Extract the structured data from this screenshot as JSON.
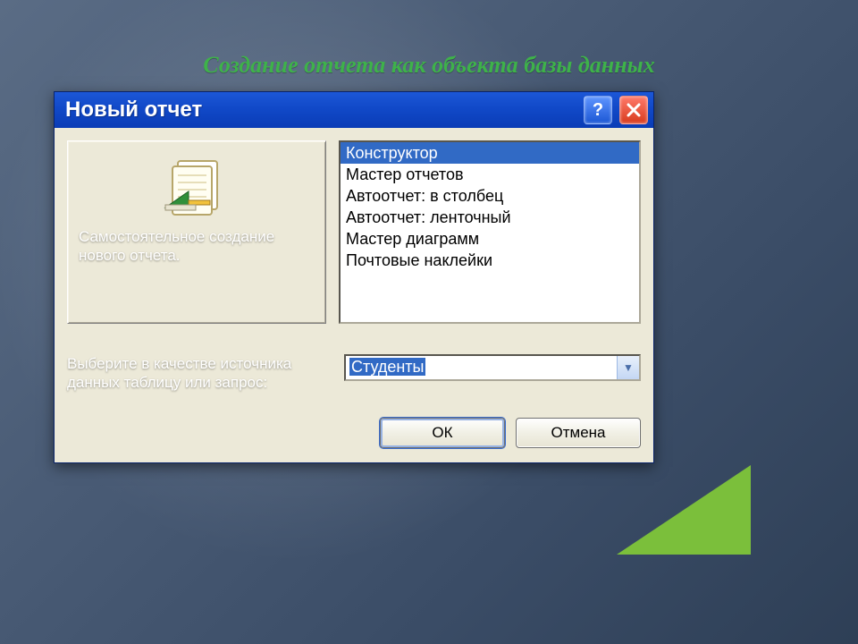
{
  "slide": {
    "title": "Создание отчета как объекта базы данных"
  },
  "dialog": {
    "title": "Новый отчет",
    "helpGlyph": "?",
    "preview": {
      "caption": "Самостоятельное создание нового отчета."
    },
    "list": {
      "items": [
        "Конструктор",
        "Мастер отчетов",
        "Автоотчет: в столбец",
        "Автоотчет: ленточный",
        "Мастер диаграмм",
        "Почтовые наклейки"
      ],
      "selectedIndex": 0
    },
    "source": {
      "label": "Выберите в качестве источника данных таблицу или запрос:",
      "value": "Студенты"
    },
    "buttons": {
      "ok": "ОК",
      "cancel": "Отмена"
    }
  }
}
